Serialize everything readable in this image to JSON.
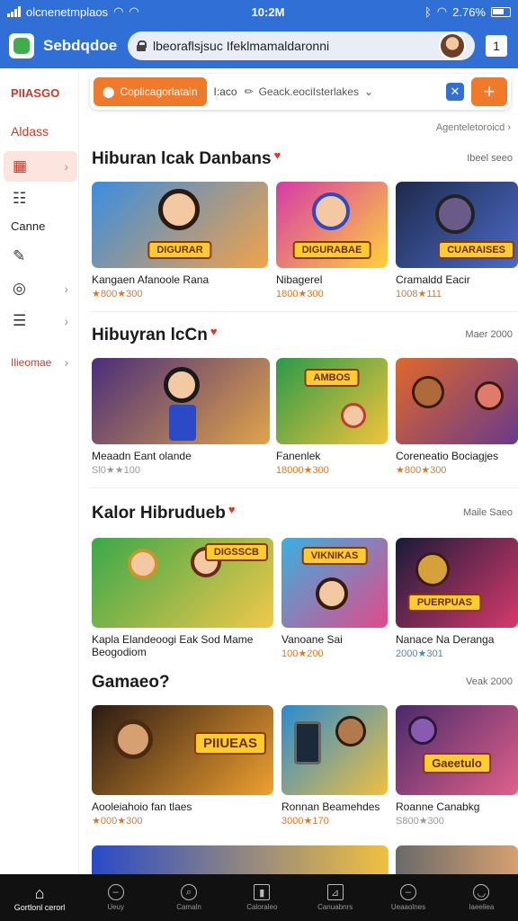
{
  "status_bar": {
    "carrier": "olcnenetmplaos",
    "time": "10:2M",
    "battery": "2.76%"
  },
  "browser": {
    "app_name": "Sebdqdoe",
    "url": "lbeoraflsjsuc Ifeklmamaldaronni",
    "tab_count": "1"
  },
  "sidebar": {
    "title": "PIIASGO",
    "subtitle": "Aldass",
    "label_game": "Canne",
    "label_bottom": "Ilieomae",
    "items": [
      {
        "icon": "calendar-icon"
      },
      {
        "icon": "grid-icon"
      },
      {
        "icon": "tag-icon"
      },
      {
        "icon": "globe-icon"
      },
      {
        "icon": "list-icon"
      }
    ]
  },
  "toolbar": {
    "pill_label": "Coplicagorlatain",
    "mid_text": "I:aco",
    "search_placeholder": "Geack.eociIsterlakes",
    "plus": "+"
  },
  "top_link": "Agenteletoroicd",
  "sections": [
    {
      "title": "Hiburan lcak Danbans",
      "more": "Ibeel seeo",
      "cards": [
        {
          "title": "Kangaen Afanoole Rana",
          "meta": "★800★300",
          "tag": "DIGURAR",
          "colors": [
            "#3a8de0",
            "#f2a24a"
          ]
        },
        {
          "title": "Nibagerel",
          "meta": "1800★300",
          "tag": "DIGURABAE",
          "colors": [
            "#d63aa8",
            "#ffd13b"
          ]
        },
        {
          "title": "Cramaldd Eacir",
          "meta": "1008★111",
          "tag": "CUARAISES",
          "colors": [
            "#1e2a4a",
            "#4a6ac8"
          ]
        }
      ]
    },
    {
      "title": "Hibuyran lcCn",
      "more": "Maer 2000",
      "cards": [
        {
          "title": "Meaadn Eant olande",
          "meta": "Sl0★★100",
          "tag": "",
          "colors": [
            "#4a2d7a",
            "#e0a44a"
          ]
        },
        {
          "title": "Fanenlek",
          "meta": "18000★300",
          "tag": "AMBOS",
          "colors": [
            "#2a9a4a",
            "#f2c43a"
          ]
        },
        {
          "title": "Coreneatio Bociagjes",
          "meta": "★800★300",
          "tag": "",
          "colors": [
            "#e0682a",
            "#6a3a8a"
          ]
        }
      ]
    },
    {
      "title": "Kalor Hibrudueb",
      "more": "Maile Saeo",
      "cards": [
        {
          "title": "Kapla Elandeoogi Eak Sod Mame",
          "title2": "Beogodiom",
          "meta": "",
          "tag": "DIGSSCB",
          "colors": [
            "#3aa84a",
            "#f2c84a"
          ]
        },
        {
          "title": "Vanoane Sai",
          "meta": "100★200",
          "tag": "VIKNIKAS",
          "colors": [
            "#3ab0e0",
            "#e04a8a"
          ]
        },
        {
          "title": "Nanace Na Deranga",
          "meta": "2000★301",
          "tag": "PUERPUAS",
          "colors": [
            "#1a1a3a",
            "#d63a6a"
          ]
        }
      ]
    },
    {
      "title": "Gamaeo?",
      "more": "Veak 2000",
      "cards": [
        {
          "title": "Aooleiahoio fan tlaes",
          "meta": "★000★300",
          "tag": "PIIUEAS",
          "colors": [
            "#2a1a14",
            "#f0a030"
          ]
        },
        {
          "title": "Ronnan Beamehdes",
          "meta": "3000★170",
          "tag": "",
          "colors": [
            "#2a8ad0",
            "#f0c040"
          ]
        },
        {
          "title": "Roanne Canabkg",
          "meta": "S800★300",
          "tag": "Gaeetulo",
          "colors": [
            "#4a2a6a",
            "#e0608a"
          ]
        }
      ]
    }
  ],
  "bottom_nav": {
    "home_label": "Gortlonl cerorl",
    "items": [
      {
        "label": "Ueuy",
        "icon": "circle-icon"
      },
      {
        "label": "Camaln",
        "icon": "search-icon"
      },
      {
        "label": "Caloraleo",
        "icon": "book-icon"
      },
      {
        "label": "Canuabnrs",
        "icon": "chart-icon"
      },
      {
        "label": "Ueaaolnes",
        "icon": "minus-icon"
      },
      {
        "label": "Iaeeliea",
        "icon": "dot-icon"
      }
    ]
  }
}
